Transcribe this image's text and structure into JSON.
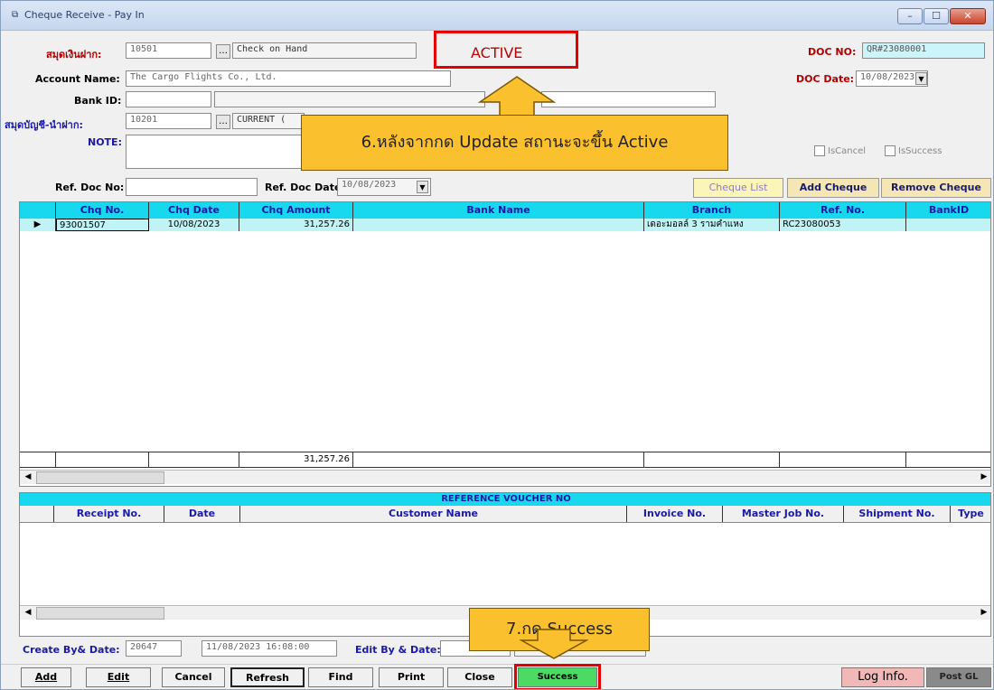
{
  "window": {
    "title": "Cheque Receive - Pay In",
    "controls": {
      "minimize": "–",
      "maximize": "☐",
      "close": "✕"
    }
  },
  "form": {
    "account_label": "สมุดเงินฝาก:",
    "account_code": "10501",
    "account_desc": "Check on Hand",
    "status": "ACTIVE",
    "doc_no_label": "DOC NO:",
    "doc_no": "QR#23080001",
    "account_name_label": "Account Name:",
    "account_name": "The Cargo Flights Co., Ltd.",
    "doc_date_label": "DOC Date:",
    "doc_date": "10/08/2023",
    "bank_id_label": "Bank ID:",
    "bank_id": "",
    "ledger_label": "สมุดบัญชี-นำฝาก:",
    "ledger_code": "10201",
    "ledger_desc": "CURRENT (",
    "note_label": "NOTE:",
    "note": "",
    "is_cancel_label": "IsCancel",
    "is_success_label": "IsSuccess",
    "ref_doc_no_label": "Ref. Doc No:",
    "ref_doc_no": "",
    "ref_doc_date_label": "Ref. Doc Date:",
    "ref_doc_date": "10/08/2023"
  },
  "cheque_actions": {
    "cheque_list": "Cheque List",
    "add_cheque": "Add Cheque",
    "remove_cheque": "Remove Cheque"
  },
  "cheque_table": {
    "headers": [
      "Chq No.",
      "Chq Date",
      "Chq Amount",
      "Bank Name",
      "Branch",
      "Ref. No.",
      "BankID"
    ],
    "rows": [
      {
        "chq_no": "93001507",
        "chq_date": "10/08/2023",
        "amount": "31,257.26",
        "bank_name": "",
        "branch": "เดอะมอลล์ 3 รามคำแหง",
        "ref_no": "RC23080053",
        "bank_id": ""
      }
    ],
    "total": "31,257.26"
  },
  "reference": {
    "title": "REFERENCE VOUCHER NO",
    "headers": [
      "Receipt No.",
      "Date",
      "Customer Name",
      "Invoice No.",
      "Master Job No.",
      "Shipment No.",
      "Type"
    ]
  },
  "footer": {
    "create_label": "Create By& Date:",
    "create_by": "20647",
    "create_date": "11/08/2023 16:08:00",
    "edit_label": "Edit By & Date:",
    "edit_by": "",
    "edit_date": ""
  },
  "toolbar": {
    "add": "Add",
    "edit": "Edit",
    "cancel": "Cancel",
    "refresh": "Refresh",
    "find": "Find",
    "print": "Print",
    "close": "Close",
    "success": "Success",
    "log_info": "Log Info.",
    "post_gl": "Post GL"
  },
  "annotations": {
    "step6": "6.หลังจากกด Update สถานะจะขึ้น Active",
    "step7": "7.กด Success"
  },
  "colors": {
    "grid_header": "#18d8ee",
    "row_highlight": "#bff3f5",
    "callout": "#fbc02d",
    "highlight_border": "#e40000",
    "success_button": "#4cd964"
  }
}
